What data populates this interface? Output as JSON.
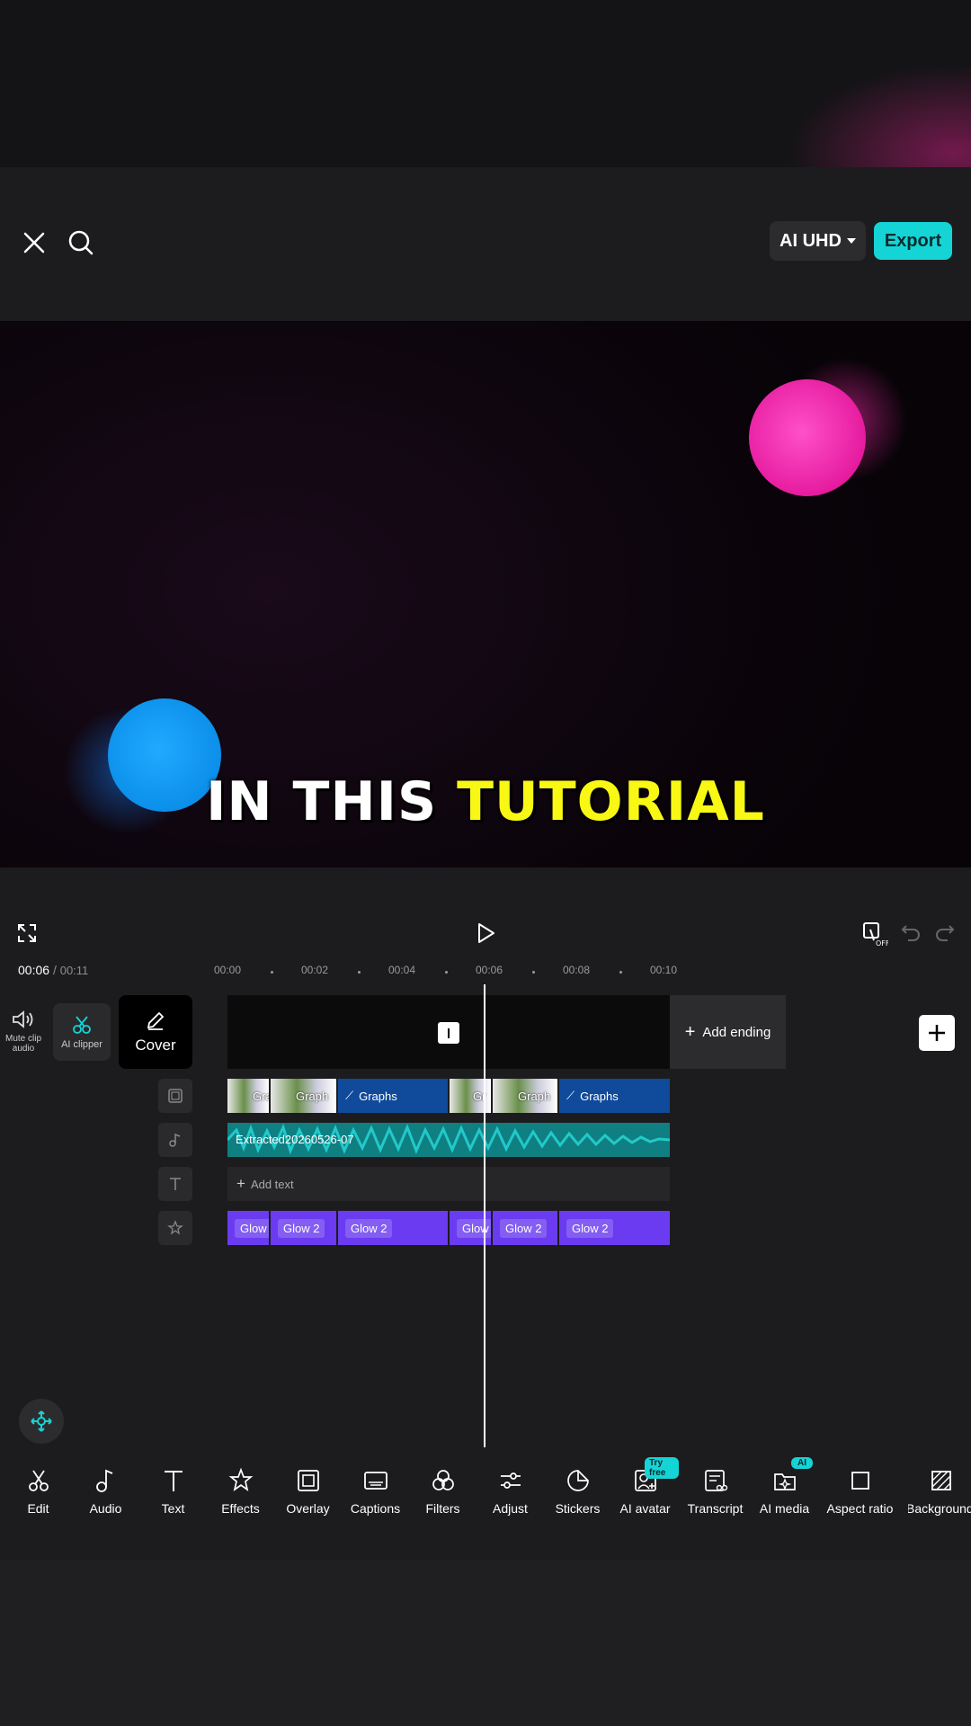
{
  "header": {
    "quality_label": "AI UHD",
    "export_label": "Export"
  },
  "preview": {
    "subtitle_white": "IN THIS",
    "subtitle_yellow": "TUTORIAL"
  },
  "timeline": {
    "current_time": "00:06",
    "total_time": "00:11",
    "ticks": [
      "00:00",
      "00:02",
      "00:04",
      "00:06",
      "00:08",
      "00:10"
    ]
  },
  "side": {
    "mute_label": "Mute clip audio",
    "ai_clipper_label": "AI clipper",
    "cover_label": "Cover"
  },
  "tracks": {
    "add_ending": "Add ending",
    "add_text": "Add text",
    "audio_name": "Extracted20260526-07",
    "graph_labels": [
      "Gra",
      "Graph",
      "Graphs",
      "Gr",
      "Graph",
      "Graphs"
    ],
    "glow_labels": [
      "Glow",
      "Glow 2",
      "Glow 2",
      "Glow",
      "Glow 2",
      "Glow 2"
    ]
  },
  "toolbar": {
    "items": [
      "Edit",
      "Audio",
      "Text",
      "Effects",
      "Overlay",
      "Captions",
      "Filters",
      "Adjust",
      "Stickers",
      "AI avatar",
      "Transcript",
      "AI media",
      "Aspect ratio",
      "Background"
    ],
    "badge_try_free": "Try free",
    "badge_ai": "AI"
  },
  "colors": {
    "accent": "#15d4d6",
    "glow_clip": "#6a3bf0",
    "graph_clip": "#104a9a",
    "subtitle_yellow": "#f8f814"
  }
}
